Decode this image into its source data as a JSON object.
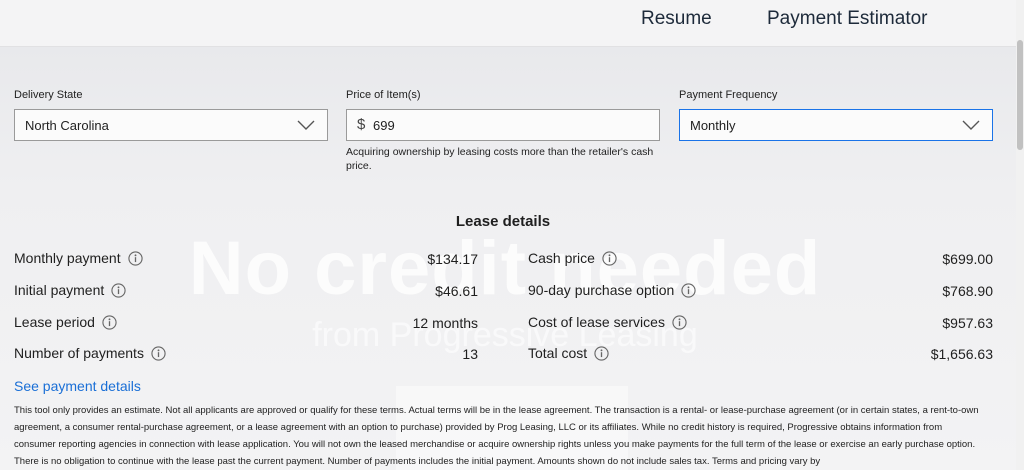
{
  "nav": {
    "resume": "Resume",
    "estimator": "Payment Estimator"
  },
  "background": {
    "headline": "No credit needed",
    "subline": "from Progressive Leasing"
  },
  "form": {
    "delivery_state": {
      "label": "Delivery State",
      "value": "North Carolina"
    },
    "price": {
      "label": "Price of Item(s)",
      "currency_symbol": "$",
      "value": "699",
      "help": "Acquiring ownership by leasing costs more than the retailer's cash price."
    },
    "frequency": {
      "label": "Payment Frequency",
      "value": "Monthly"
    }
  },
  "lease": {
    "title": "Lease details",
    "left": [
      {
        "label": "Monthly payment",
        "value": "$134.17"
      },
      {
        "label": "Initial payment",
        "value": "$46.61"
      },
      {
        "label": "Lease period",
        "value": "12 months"
      },
      {
        "label": "Number of payments",
        "value": "13"
      }
    ],
    "right": [
      {
        "label": "Cash price",
        "value": "$699.00"
      },
      {
        "label": "90-day purchase option",
        "value": "$768.90"
      },
      {
        "label": "Cost of lease services",
        "value": "$957.63"
      },
      {
        "label": "Total cost",
        "value": "$1,656.63"
      }
    ]
  },
  "details_link": "See payment details",
  "disclaimer": "This tool only provides an estimate. Not all applicants are approved or qualify for these terms. Actual terms will be in the lease agreement. The transaction is a rental- or lease-purchase agreement (or in certain states, a rent-to-own agreement, a consumer rental-purchase agreement, or a lease agreement with an option to purchase) provided by Prog Leasing, LLC or its affiliates. While no credit history is required, Progressive obtains information from consumer reporting agencies in connection with lease application. You will not own the leased merchandise or acquire ownership rights unless you make payments for the full term of the lease or exercise an early purchase option. There is no obligation to continue with the lease past the current payment. Number of payments includes the initial payment. Amounts shown do not include sales tax. Terms and pricing vary by",
  "colors": {
    "accent": "#1a73e8",
    "link": "#1a6fd6"
  },
  "icons": {
    "select_indicator": "chevron-down-icon",
    "info": "info-icon"
  }
}
